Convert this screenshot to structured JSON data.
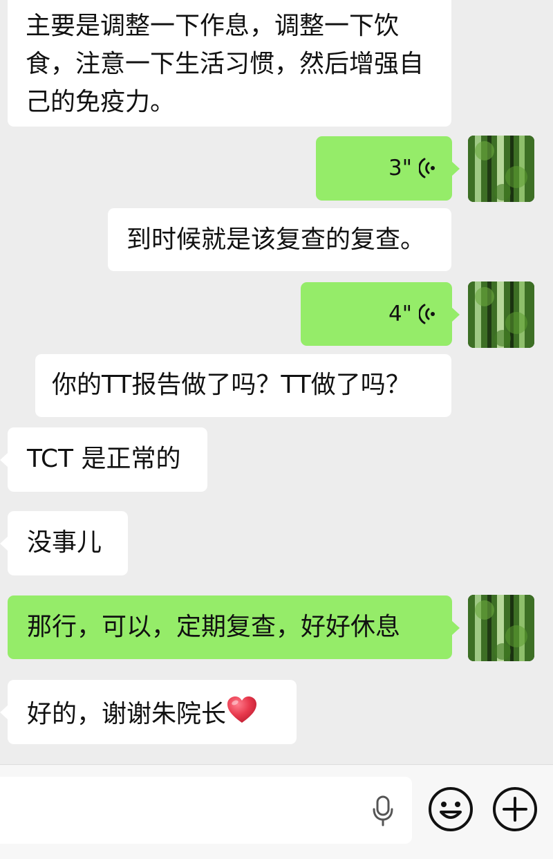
{
  "messages": [
    {
      "sender": "other",
      "type": "text",
      "text": "主要是调整一下作息，调整一下饮食，注意一下生活习惯，然后增强自己的免疫力。"
    },
    {
      "sender": "self",
      "type": "voice",
      "duration": "3\""
    },
    {
      "sender": "other",
      "type": "text",
      "text": "到时候就是该复查的复查。"
    },
    {
      "sender": "self",
      "type": "voice",
      "duration": "4\""
    },
    {
      "sender": "other",
      "type": "text",
      "text": "你的TT报告做了吗？TT做了吗？"
    },
    {
      "sender": "other",
      "type": "text",
      "text": "TCT 是正常的"
    },
    {
      "sender": "other",
      "type": "text",
      "text": "没事儿"
    },
    {
      "sender": "self",
      "type": "text",
      "text": "那行，可以，定期复查，好好休息"
    },
    {
      "sender": "other",
      "type": "text",
      "text": "好的，谢谢朱院长"
    }
  ],
  "emoji": {
    "name": "heart-emoji",
    "color": "#e8394d"
  },
  "input_bar": {
    "value": "",
    "icons": [
      "microphone-icon",
      "emoji-face-icon",
      "plus-icon"
    ]
  },
  "colors": {
    "background": "#ededed",
    "incoming_bubble": "#ffffff",
    "outgoing_bubble": "#95ec69"
  }
}
